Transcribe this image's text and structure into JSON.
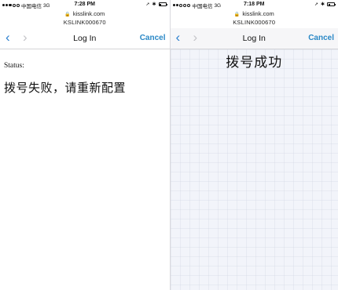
{
  "left_screen": {
    "status_bar": {
      "carrier": "中国电信",
      "network": "3G",
      "time": "7:28 PM",
      "signal_bars": 3,
      "battery_level": 0.25
    },
    "url": {
      "domain": "kisslink.com",
      "ssid": "KSLINK000670"
    },
    "nav": {
      "back": "‹",
      "forward": "›",
      "title": "Log In",
      "cancel": "Cancel"
    },
    "content": {
      "status_label": "Status:",
      "message": "拨号失败，请重新配置"
    }
  },
  "right_screen": {
    "status_bar": {
      "carrier": "中国电信",
      "network": "3G",
      "time": "7:18 PM",
      "signal_bars": 2,
      "battery_level": 0.25
    },
    "url": {
      "domain": "kisslink.com",
      "ssid": "KSLINK000670"
    },
    "nav": {
      "back": "‹",
      "forward": "›",
      "title": "Log In",
      "cancel": "Cancel"
    },
    "content": {
      "message": "拨号成功"
    }
  },
  "colors": {
    "link": "#2a88c6",
    "disabled": "#c4c4c8"
  }
}
